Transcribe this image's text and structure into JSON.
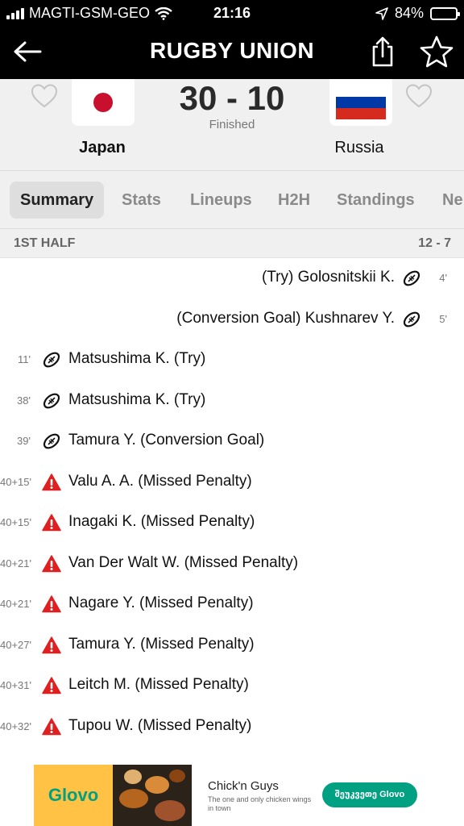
{
  "status_bar": {
    "carrier": "MAGTI-GSM-GEO",
    "time": "21:16",
    "battery": "84%",
    "battery_level": 0.84
  },
  "app_bar": {
    "title": "RUGBY UNION",
    "icons": [
      "back-arrow-icon",
      "share-icon",
      "star-icon"
    ]
  },
  "match": {
    "home_team": "Japan",
    "away_team": "Russia",
    "score": "30 - 10",
    "status": "Finished",
    "colors": {
      "japan_red": "#c8102e",
      "russia_white": "#ffffff",
      "russia_blue": "#0039a6",
      "russia_red": "#d52b1e"
    }
  },
  "tabs": [
    "Summary",
    "Stats",
    "Lineups",
    "H2H",
    "Standings",
    "Ne"
  ],
  "active_tab": "Summary",
  "half": {
    "label": "1ST HALF",
    "score": "12 - 7"
  },
  "events": [
    {
      "side": "away",
      "minute": "4'",
      "icon": "rugby-ball-icon",
      "text": "(Try) Golosnitskii K."
    },
    {
      "side": "away",
      "minute": "5'",
      "icon": "rugby-ball-icon",
      "text": "(Conversion Goal) Kushnarev Y."
    },
    {
      "side": "home",
      "minute": "11'",
      "icon": "rugby-ball-icon",
      "text": "Matsushima K. (Try)"
    },
    {
      "side": "home",
      "minute": "38'",
      "icon": "rugby-ball-icon",
      "text": "Matsushima K. (Try)"
    },
    {
      "side": "home",
      "minute": "39'",
      "icon": "rugby-ball-icon",
      "text": "Tamura Y. (Conversion Goal)"
    },
    {
      "side": "home",
      "minute": "40+15'",
      "icon": "warning-icon",
      "text": "Valu A. A. (Missed Penalty)"
    },
    {
      "side": "home",
      "minute": "40+15'",
      "icon": "warning-icon",
      "text": "Inagaki K. (Missed Penalty)"
    },
    {
      "side": "home",
      "minute": "40+21'",
      "icon": "warning-icon",
      "text": "Van Der Walt W. (Missed Penalty)"
    },
    {
      "side": "home",
      "minute": "40+21'",
      "icon": "warning-icon",
      "text": "Nagare Y. (Missed Penalty)"
    },
    {
      "side": "home",
      "minute": "40+27'",
      "icon": "warning-icon",
      "text": "Tamura Y. (Missed Penalty)"
    },
    {
      "side": "home",
      "minute": "40+31'",
      "icon": "warning-icon",
      "text": "Leitch M. (Missed Penalty)"
    },
    {
      "side": "home",
      "minute": "40+32'",
      "icon": "warning-icon",
      "text": "Tupou W. (Missed Penalty)"
    }
  ],
  "ad": {
    "brand": "Glovo",
    "title": "Chick'n Guys",
    "description": "The one and only chicken wings in town",
    "cta": "შეუკვეთე Glovo",
    "colors": {
      "brand_yellow": "#ffc244",
      "brand_green": "#00a082"
    }
  }
}
